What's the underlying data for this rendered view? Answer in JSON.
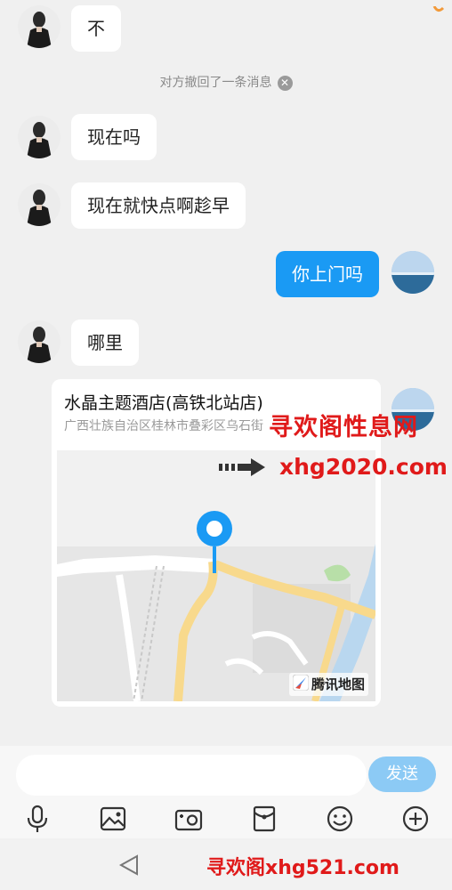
{
  "messages": {
    "m1": "不",
    "recall_notice": "对方撤回了一条消息",
    "m2": "现在吗",
    "m3": "现在就快点啊趁早",
    "m4_self": "你上门吗",
    "m5": "哪里"
  },
  "location_card": {
    "title": "水晶主题酒店(高铁北站店)",
    "address": "广西壮族自治区桂林市叠彩区乌石街",
    "map_brand": "腾讯地图"
  },
  "watermarks": {
    "line1": "寻欢阁性息网",
    "line2": "xhg2020.com",
    "line3": "寻欢阁xhg521.com"
  },
  "input": {
    "placeholder": "",
    "send_label": "发送"
  },
  "toolbar_icons": [
    "microphone-icon",
    "image-icon",
    "camera-icon",
    "red-packet-icon",
    "emoji-icon",
    "plus-icon"
  ],
  "colors": {
    "self_bubble": "#1a9af4",
    "send_button": "#8ccaf5",
    "watermark": "#e01a1a"
  }
}
